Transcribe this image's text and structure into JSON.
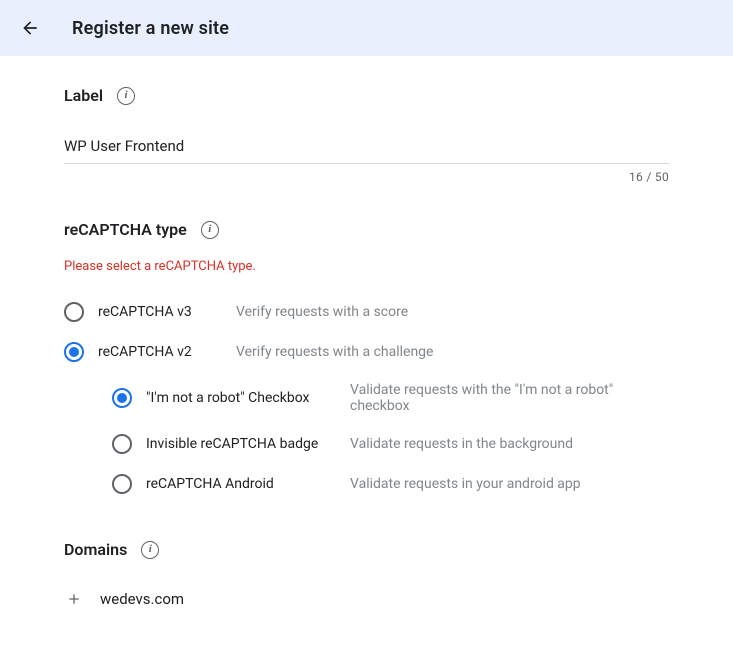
{
  "header": {
    "title": "Register a new site"
  },
  "label_section": {
    "title": "Label",
    "value": "WP User Frontend",
    "count": "16 / 50"
  },
  "type_section": {
    "title": "reCAPTCHA type",
    "error": "Please select a reCAPTCHA type.",
    "options": [
      {
        "label": "reCAPTCHA v3",
        "desc": "Verify requests with a score",
        "selected": false
      },
      {
        "label": "reCAPTCHA v2",
        "desc": "Verify requests with a challenge",
        "selected": true
      }
    ],
    "sub_options": [
      {
        "label": "\"I'm not a robot\" Checkbox",
        "desc": "Validate requests with the \"I'm not a robot\" checkbox",
        "selected": true
      },
      {
        "label": "Invisible reCAPTCHA badge",
        "desc": "Validate requests in the background",
        "selected": false
      },
      {
        "label": "reCAPTCHA Android",
        "desc": "Validate requests in your android app",
        "selected": false
      }
    ]
  },
  "domains_section": {
    "title": "Domains",
    "domain": "wedevs.com"
  }
}
